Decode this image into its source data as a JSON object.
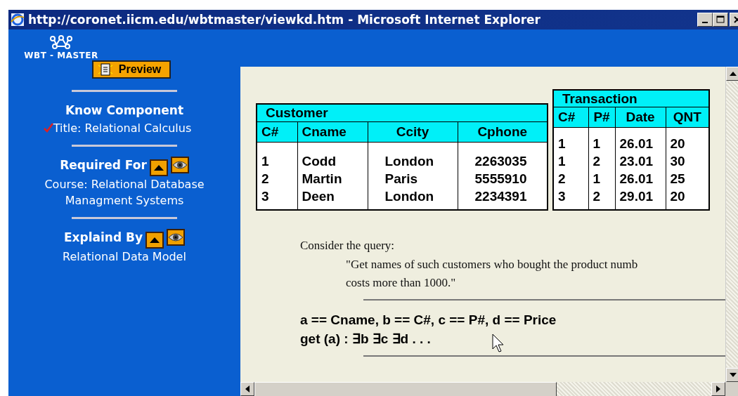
{
  "window": {
    "title": "http://coronet.iicm.edu/wbtmaster/viewkd.htm - Microsoft Internet Explorer"
  },
  "sidebar": {
    "logo_text": "WBT - MASTER",
    "preview_button": "Preview",
    "sections": [
      {
        "kind": "plain",
        "heading": "Know Component",
        "text": "Title: Relational Calculus",
        "checked": true
      },
      {
        "kind": "navigable",
        "heading": "Required For",
        "text": "Course: Relational Database Managment Systems",
        "checked": false
      },
      {
        "kind": "navigable",
        "heading": "Explaind By",
        "text": "Relational Data Model",
        "checked": false
      }
    ]
  },
  "tables": [
    {
      "title": "Customer",
      "columns": [
        "C#",
        "Cname",
        "Ccity",
        "Cphone"
      ],
      "rows": [
        [
          "1",
          "Codd",
          "London",
          "2263035"
        ],
        [
          "2",
          "Martin",
          "Paris",
          "5555910"
        ],
        [
          "3",
          "Deen",
          "London",
          "2234391"
        ]
      ]
    },
    {
      "title": "Transaction",
      "columns": [
        "C#",
        "P#",
        "Date",
        "QNT"
      ],
      "rows": [
        [
          "1",
          "1",
          "26.01",
          "20"
        ],
        [
          "1",
          "2",
          "23.01",
          "30"
        ],
        [
          "2",
          "1",
          "26.01",
          "25"
        ],
        [
          "3",
          "2",
          "29.01",
          "20"
        ]
      ]
    }
  ],
  "query": {
    "intro": "Consider the query:",
    "quote_lines": [
      "\"Get names of such customers who bought the product numb",
      "costs more than 1000.\""
    ]
  },
  "formula_lines": [
    "a == Cname, b == C#, c == P#, d == Price",
    "get (a) : ∃b ∃c ∃d . . ."
  ]
}
